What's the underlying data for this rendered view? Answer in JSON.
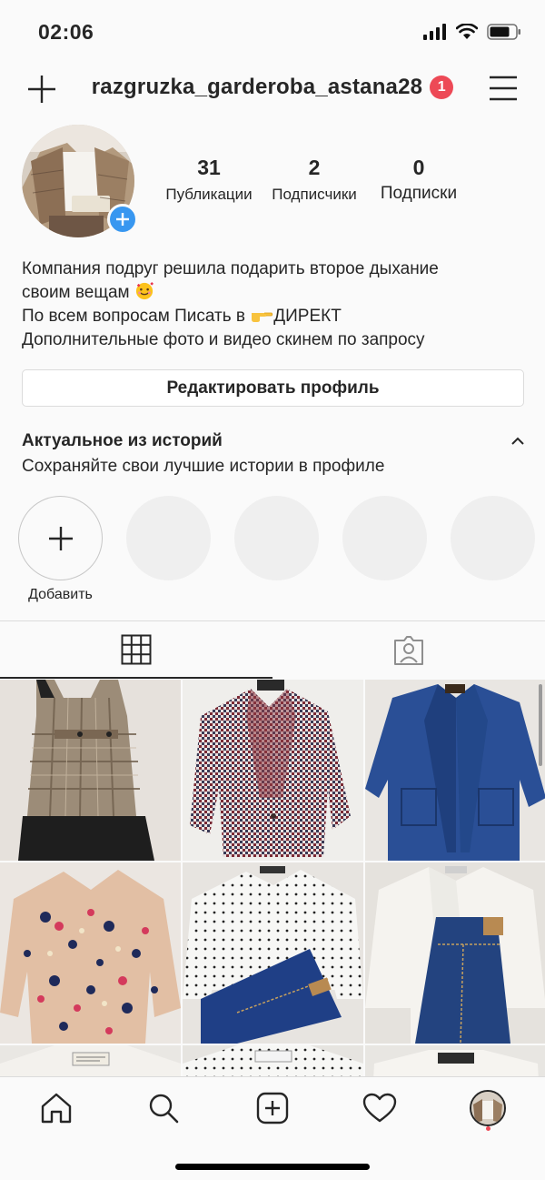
{
  "status_bar": {
    "time": "02:06"
  },
  "header": {
    "username": "razgruzka_garderoba_astana28",
    "notification_count": "1"
  },
  "stats": [
    {
      "value": "31",
      "label": "Публикации"
    },
    {
      "value": "2",
      "label": "Подписчики"
    },
    {
      "value": "0",
      "label": "Подписки"
    }
  ],
  "bio": {
    "line1": "Компания подруг решила подарить второе дыхание",
    "line2": "своим вещам",
    "line3_prefix": "По всем вопросам Писать в",
    "line3_suffix": "ДИРЕКТ",
    "line4": "Дополнительные фото и видео скинем по запросу"
  },
  "edit_profile_label": "Редактировать профиль",
  "highlights": {
    "title": "Актуальное из историй",
    "subtitle": "Сохраняйте свои лучшие истории в профиле",
    "add_label": "Добавить"
  },
  "colors": {
    "badge": "#ed4956",
    "avatar_add": "#3897f0",
    "text": "#262626",
    "divider": "#dbdbdb"
  },
  "icons": [
    "plus-icon",
    "menu-icon",
    "grid-icon",
    "tagged-icon",
    "home-icon",
    "search-icon",
    "new-post-icon",
    "heart-icon"
  ],
  "posts": [
    {
      "name": "plaid-pinafore-dress"
    },
    {
      "name": "houndstooth-blazer"
    },
    {
      "name": "blue-coat"
    },
    {
      "name": "floral-print-shirt"
    },
    {
      "name": "polka-dot-blouse-and-jeans"
    },
    {
      "name": "white-blouse-and-jeans"
    },
    {
      "name": "white-jacket"
    },
    {
      "name": "polka-dot-shirt"
    },
    {
      "name": "white-top"
    }
  ]
}
